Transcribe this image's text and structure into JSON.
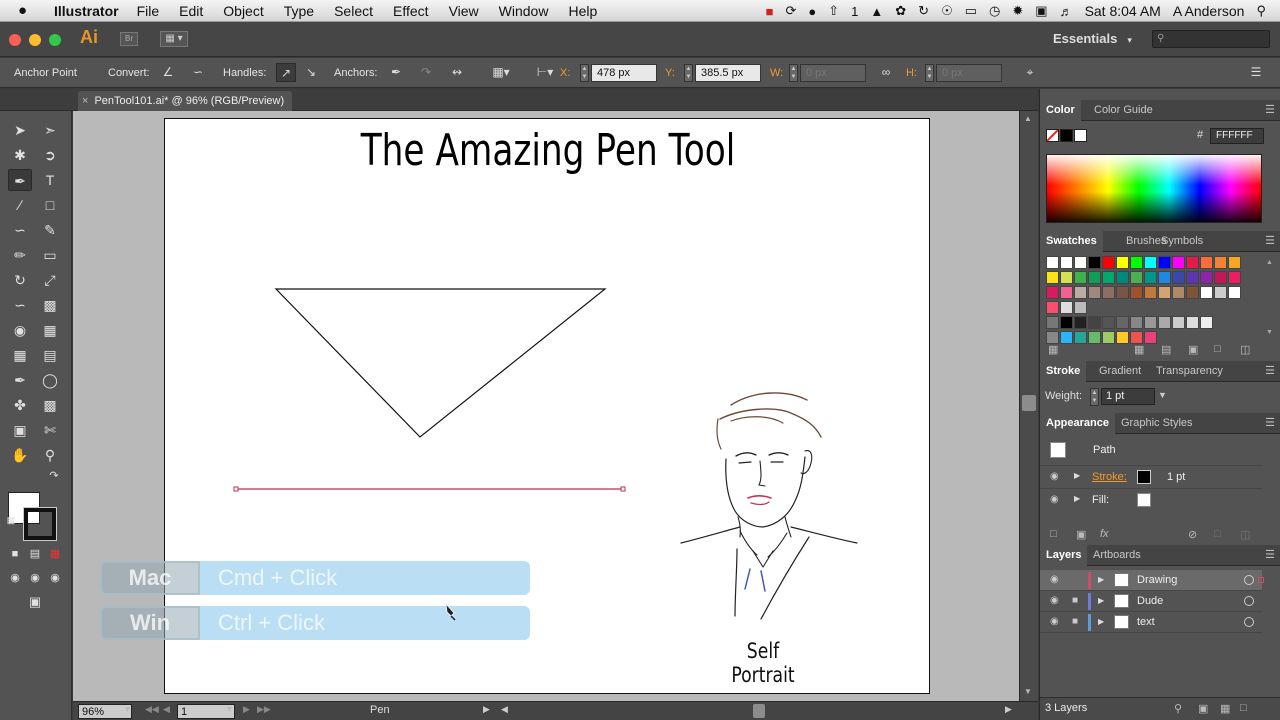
{
  "menubar": {
    "apple": "",
    "app_name": "Illustrator",
    "menus": [
      "File",
      "Edit",
      "Object",
      "Type",
      "Select",
      "Effect",
      "View",
      "Window",
      "Help"
    ],
    "notification_count": "1",
    "clock": "Sat 8:04 AM",
    "user": "A Anderson"
  },
  "appbar": {
    "logo": "Ai",
    "bridge": "Br",
    "workspace": "Essentials",
    "search_placeholder": "",
    "colors": {
      "close": "#fc5f57",
      "minimize": "#fdbc2e",
      "zoom": "#35c749",
      "logo": "#e89624"
    }
  },
  "control": {
    "anchor_point": "Anchor Point",
    "convert": "Convert:",
    "handles": "Handles:",
    "anchors": "Anchors:",
    "x_label": "X:",
    "x_value": "478 px",
    "y_label": "Y:",
    "y_value": "385.5 px",
    "w_label": "W:",
    "w_value": "0 px",
    "h_label": "H:",
    "h_value": "0 px"
  },
  "document": {
    "tab_title": "PenTool101.ai* @ 96% (RGB/Preview)",
    "title": "The Amazing Pen Tool",
    "caption": "Self Portrait",
    "overlay": [
      {
        "os": "Mac",
        "keys": "Cmd + Click"
      },
      {
        "os": "Win",
        "keys": "Ctrl + Click"
      }
    ]
  },
  "status": {
    "zoom": "96%",
    "page": "1",
    "tool": "Pen"
  },
  "panels": {
    "color_tabs": [
      "Color",
      "Color Guide"
    ],
    "hex_label": "#",
    "hex_value": "FFFFFF",
    "swatch_tabs": [
      "Swatches",
      "Brushes",
      "Symbols"
    ],
    "stroke_tabs": [
      "Stroke",
      "Gradient",
      "Transparency"
    ],
    "weight_label": "Weight:",
    "weight_value": "1 pt",
    "appearance_tabs": [
      "Appearance",
      "Graphic Styles"
    ],
    "appearance_path": "Path",
    "stroke_label": "Stroke:",
    "stroke_value": "1 pt",
    "fill_label": "Fill:",
    "layers_tabs": [
      "Layers",
      "Artboards"
    ],
    "layers": [
      {
        "name": "Drawing",
        "color": "#d24b6a"
      },
      {
        "name": "Dude",
        "color": "#6b7fd6"
      },
      {
        "name": "text",
        "color": "#5d9ed6"
      }
    ],
    "layers_count": "3 Layers"
  }
}
